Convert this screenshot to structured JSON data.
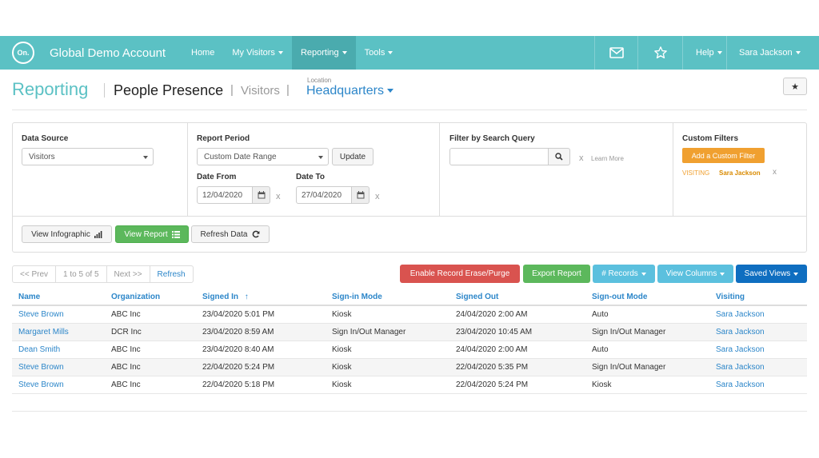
{
  "navbar": {
    "logo": "On.",
    "account": "Global Demo Account",
    "items": [
      {
        "label": "Home"
      },
      {
        "label": "My Visitors"
      },
      {
        "label": "Reporting"
      },
      {
        "label": "Tools"
      }
    ],
    "help": "Help",
    "user": "Sara Jackson",
    "icons": [
      "mail-icon",
      "star-icon"
    ],
    "color": "#5bc1c4"
  },
  "header": {
    "title": "Reporting",
    "subtitle": "People Presence",
    "crumb": "Visitors",
    "separator": "|",
    "location_label": "Location",
    "location": "Headquarters",
    "star": "★"
  },
  "filters": {
    "data_source": {
      "label": "Data Source",
      "value": "Visitors"
    },
    "report_period": {
      "label": "Report Period",
      "value": "Custom Date Range",
      "update": "Update"
    },
    "date_from": {
      "label": "Date From",
      "value": "12/04/2020"
    },
    "date_to": {
      "label": "Date To",
      "value": "27/04/2020"
    },
    "search": {
      "label": "Filter by Search Query",
      "value": "",
      "learn_more": "Learn More"
    },
    "custom": {
      "label": "Custom Filters",
      "add": "Add a Custom Filter",
      "chip_key": "VISITING",
      "chip_value": "Sara Jackson"
    },
    "clear": "x",
    "view_infographic": "View Infographic",
    "view_report": "View Report",
    "refresh_data": "Refresh Data"
  },
  "pager": {
    "prev": "<< Prev",
    "range": "1 to 5 of 5",
    "next": "Next >>",
    "refresh": "Refresh"
  },
  "actions": {
    "erase": "Enable Record Erase/Purge",
    "export": "Export Report",
    "records": "# Records",
    "columns": "View Columns",
    "saved": "Saved Views"
  },
  "table": {
    "headers": [
      "Name",
      "Organization",
      "Signed In",
      "Sign-in Mode",
      "Signed Out",
      "Sign-out Mode",
      "Visiting"
    ],
    "sort_indicator": "↑",
    "rows": [
      [
        "Steve Brown",
        "ABC Inc",
        "23/04/2020 5:01 PM",
        "Kiosk",
        "24/04/2020 2:00 AM",
        "Auto",
        "Sara Jackson"
      ],
      [
        "Margaret Mills",
        "DCR Inc",
        "23/04/2020 8:59 AM",
        "Sign In/Out Manager",
        "23/04/2020 10:45 AM",
        "Sign In/Out Manager",
        "Sara Jackson"
      ],
      [
        "Dean Smith",
        "ABC Inc",
        "23/04/2020 8:40 AM",
        "Kiosk",
        "24/04/2020 2:00 AM",
        "Auto",
        "Sara Jackson"
      ],
      [
        "Steve Brown",
        "ABC Inc",
        "22/04/2020 5:24 PM",
        "Kiosk",
        "22/04/2020 5:35 PM",
        "Sign In/Out Manager",
        "Sara Jackson"
      ],
      [
        "Steve Brown",
        "ABC Inc",
        "22/04/2020 5:18 PM",
        "Kiosk",
        "22/04/2020 5:24 PM",
        "Kiosk",
        "Sara Jackson"
      ]
    ]
  }
}
